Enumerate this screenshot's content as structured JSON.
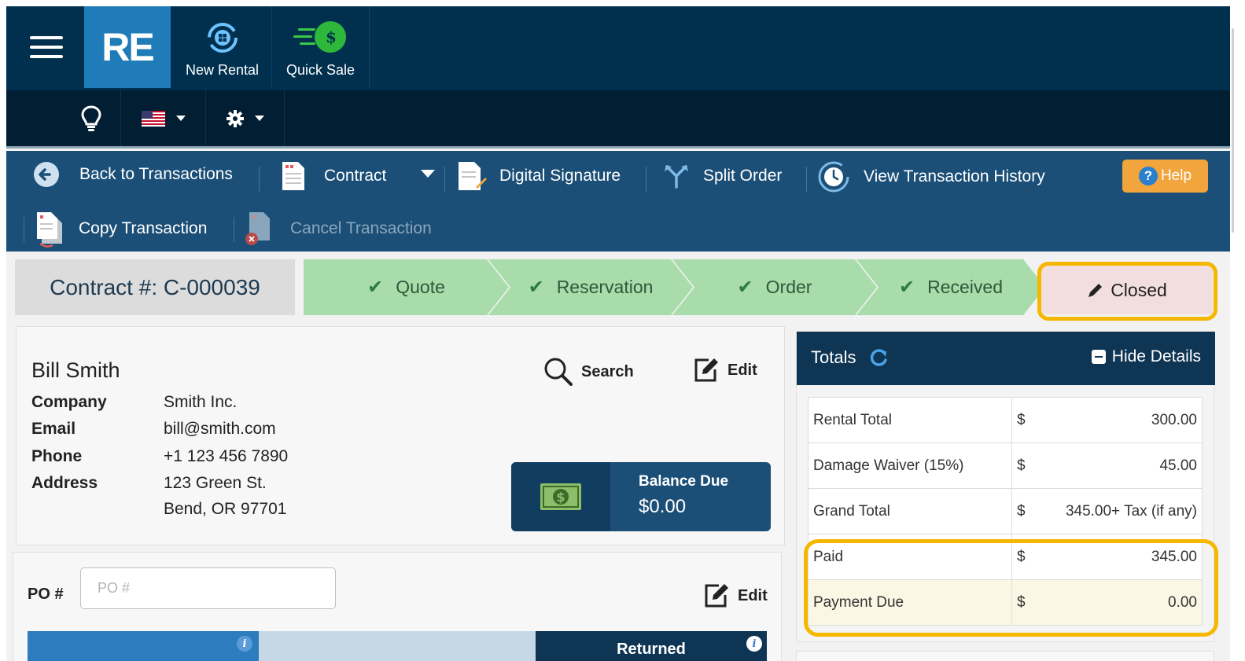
{
  "app": {
    "logo_text": "RE",
    "top_buttons": [
      {
        "label": "New Rental"
      },
      {
        "label": "Quick Sale"
      }
    ],
    "quick_sale_badge": "$"
  },
  "toolbar": {
    "back": "Back to Transactions",
    "contract": "Contract",
    "digital_signature": "Digital Signature",
    "split_order": "Split Order",
    "history": "View Transaction History",
    "help": "Help",
    "copy": "Copy Transaction",
    "cancel": "Cancel Transaction"
  },
  "status": {
    "contract_label": "Contract #: C-000039",
    "steps": [
      {
        "label": "Quote",
        "done": true
      },
      {
        "label": "Reservation",
        "done": true
      },
      {
        "label": "Order",
        "done": true
      },
      {
        "label": "Received",
        "done": true
      }
    ],
    "current": "Closed"
  },
  "customer": {
    "name": "Bill Smith",
    "search_label": "Search",
    "edit_label": "Edit",
    "fields": [
      {
        "label": "Company",
        "value": "Smith Inc."
      },
      {
        "label": "Email",
        "value": "bill@smith.com"
      },
      {
        "label": "Phone",
        "value": "+1 123 456 7890"
      },
      {
        "label": "Address",
        "value": "123 Green St."
      }
    ],
    "address_line2": "Bend, OR 97701"
  },
  "balance": {
    "label": "Balance Due",
    "value": "$0.00"
  },
  "po": {
    "label": "PO #",
    "placeholder": "PO #",
    "value": "",
    "edit_label": "Edit"
  },
  "status_bar": {
    "returned_label": "Returned"
  },
  "totals": {
    "title": "Totals",
    "hide_details": "Hide Details",
    "rows": [
      {
        "label": "Rental Total",
        "currency": "$",
        "value": "300.00"
      },
      {
        "label": "Damage Waiver (15%)",
        "currency": "$",
        "value": "45.00"
      },
      {
        "label": "Grand Total",
        "currency": "$",
        "value": "345.00+ Tax (if any)"
      },
      {
        "label": "Paid",
        "currency": "$",
        "value": "345.00"
      },
      {
        "label": "Payment Due",
        "currency": "$",
        "value": "0.00"
      }
    ]
  },
  "colors": {
    "nav_bg": "#00304e",
    "toolbar_bg": "#1b4f77",
    "step_done": "#a8dcaa",
    "step_current": "#f2dede",
    "highlight": "#f6b700",
    "help_button": "#f1a53c"
  },
  "icons": {
    "menu": "hamburger-icon",
    "new_rental": "rental-cycle-icon",
    "quick_sale": "dollar-coin-icon",
    "tips": "lightbulb-icon",
    "language": "us-flag-icon",
    "settings": "gear-icon",
    "back": "arrow-left-circle-icon",
    "contract": "document-icon",
    "signature": "document-pen-icon",
    "split": "split-arrows-icon",
    "history": "clock-history-icon",
    "copy": "copy-document-icon",
    "cancel": "document-cancel-icon",
    "search": "search-icon",
    "edit": "edit-icon",
    "money": "money-bill-icon",
    "refresh": "refresh-icon",
    "minus": "minus-square-icon",
    "info": "info-icon",
    "check": "check-icon",
    "pencil": "pencil-icon",
    "help": "question-circle-icon"
  }
}
